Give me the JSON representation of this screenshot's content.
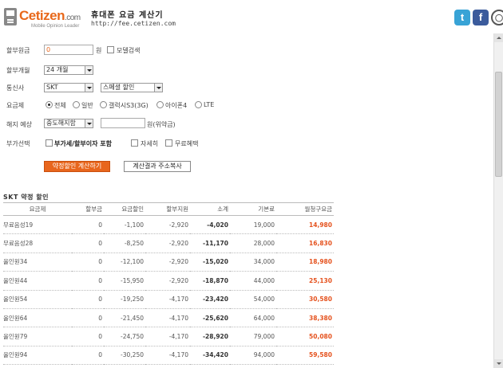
{
  "header": {
    "logo_name": "Cetizen",
    "logo_tld": ".com",
    "logo_tagline": "Mobile Opinion Leader",
    "title": "휴대폰 요금 계산기",
    "url": "http://fee.cetizen.com",
    "social": {
      "twitter": "t",
      "facebook": "f",
      "talk": "◯"
    }
  },
  "form": {
    "installment_label": "할부원금",
    "installment_value": "0",
    "installment_unit": "원",
    "model_search_label": "모델검색",
    "months_label": "할부개월",
    "months_value": "24 개월",
    "carrier_label": "통신사",
    "carrier_value": "SKT",
    "discount_value": "스페셜 할인",
    "plan_label": "요금제",
    "plan_options": [
      "전체",
      "일반",
      "갤럭시S3(3G)",
      "아이폰4",
      "LTE"
    ],
    "plan_selected": "전체",
    "cancel_label": "해지 예상",
    "cancel_value": "중도해지함",
    "cancel_unit": "원(위약금)",
    "extra_label": "부가선택",
    "extra_options": [
      "부가세/할부이자 포함",
      "자세히",
      "무료혜택"
    ],
    "calc_button": "약정할인 계산하기",
    "copy_button": "계산결과 주소복사"
  },
  "table": {
    "title": "SKT 약정 할인",
    "columns": [
      "요금제",
      "할부금",
      "요금할인",
      "할부지원",
      "소계",
      "기본료",
      "월청구요금"
    ],
    "rows": [
      [
        "무료음성19",
        "0",
        "-1,100",
        "-2,920",
        "-4,020",
        "19,000",
        "14,980"
      ],
      [
        "무료음성28",
        "0",
        "-8,250",
        "-2,920",
        "-11,170",
        "28,000",
        "16,830"
      ],
      [
        "올인원34",
        "0",
        "-12,100",
        "-2,920",
        "-15,020",
        "34,000",
        "18,980"
      ],
      [
        "올인원44",
        "0",
        "-15,950",
        "-2,920",
        "-18,870",
        "44,000",
        "25,130"
      ],
      [
        "올인원54",
        "0",
        "-19,250",
        "-4,170",
        "-23,420",
        "54,000",
        "30,580"
      ],
      [
        "올인원64",
        "0",
        "-21,450",
        "-4,170",
        "-25,620",
        "64,000",
        "38,380"
      ],
      [
        "올인원79",
        "0",
        "-24,750",
        "-4,170",
        "-28,920",
        "79,000",
        "50,080"
      ],
      [
        "올인원94",
        "0",
        "-30,250",
        "-4,170",
        "-34,420",
        "94,000",
        "59,580"
      ]
    ]
  },
  "colors": {
    "accent": "#e8661d",
    "monthly": "#e5521e",
    "twitter": "#38a3d6",
    "facebook": "#3b5b9c"
  }
}
